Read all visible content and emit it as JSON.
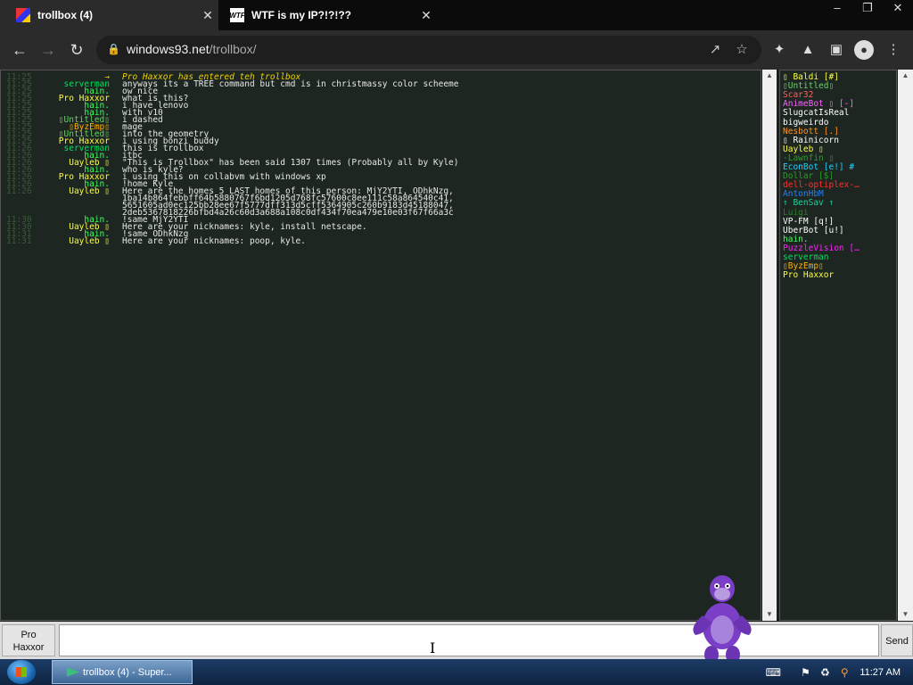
{
  "browser": {
    "tabs": [
      {
        "label": "trollbox (4)"
      },
      {
        "label": "WTF is my IP?!?!??"
      }
    ],
    "tab2_favicon": "WTF",
    "close_glyph": "✕",
    "window_controls": [
      "–",
      "❐",
      "✕"
    ],
    "url_host": "windows93.net",
    "url_path": "/trollbox/"
  },
  "chat": {
    "messages": [
      {
        "time": "11:25",
        "nick": "→",
        "nick_color": "#f0d000",
        "text": "Pro Haxxor has entered teh trollbox",
        "italic": true,
        "text_color": "#f0d000"
      },
      {
        "time": "11:25",
        "nick": "serverman",
        "nick_color": "#00e060",
        "text": "anyways its a TREE command but cmd is in christmassy color scheeme"
      },
      {
        "time": "11:25",
        "nick": "hain.",
        "nick_color": "#40ff60",
        "text": "ow nice"
      },
      {
        "time": "11:25",
        "nick": "Pro Haxxor",
        "nick_color": "#ffff40",
        "text": "what is this?"
      },
      {
        "time": "11:25",
        "nick": "hain.",
        "nick_color": "#40ff60",
        "text": "i have lenovo"
      },
      {
        "time": "11:25",
        "nick": "hain.",
        "nick_color": "#40ff60",
        "text": "with v10"
      },
      {
        "time": "11:25",
        "nick": "▯Untitled▯",
        "nick_color": "#6cd06c",
        "text": "i dashed"
      },
      {
        "time": "11:25",
        "nick": "▯ByzEmp▯",
        "nick_color": "#ffb000",
        "text": "mage"
      },
      {
        "time": "11:25",
        "nick": "▯Untitled▯",
        "nick_color": "#6cd06c",
        "text": "into the geometry"
      },
      {
        "time": "11:25",
        "nick": "Pro Haxxor",
        "nick_color": "#ffff40",
        "text": "i using bonzi buddy"
      },
      {
        "time": "11:26",
        "nick": "serverman",
        "nick_color": "#00e060",
        "text": "this is trollbox"
      },
      {
        "time": "11:26",
        "nick": "hain.",
        "nick_color": "#40ff60",
        "text": "itbc"
      },
      {
        "time": "11:26",
        "nick": "Uayleb ▯",
        "nick_color": "#ffff40",
        "text": "\"This is Trollbox\" has been said 1307 times (Probably all by Kyle)"
      },
      {
        "time": "11:26",
        "nick": "hain.",
        "nick_color": "#40ff60",
        "text": "who is kyle?"
      },
      {
        "time": "11:26",
        "nick": "Pro Haxxor",
        "nick_color": "#ffff40",
        "text": "i using this on collabvm with windows xp"
      },
      {
        "time": "11:26",
        "nick": "hain.",
        "nick_color": "#40ff60",
        "text": "!home Kyle"
      },
      {
        "time": "11:26",
        "nick": "Uayleb ▯",
        "nick_color": "#ffff40",
        "text": "Here are the homes 5 LAST homes of this person: MjY2YTI, ODhkNzg,"
      },
      {
        "time": "",
        "nick": "",
        "nick_color": "#ffff40",
        "text": "1ba14b864febbff64b5880767f6bd1205d768fc57600c8ee111c58a864540c41,"
      },
      {
        "time": "",
        "nick": "",
        "nick_color": "#ffff40",
        "text": "5651605ad0ec125bb28ee67f5777dff313d5cff5364905c260b9183d45188047,"
      },
      {
        "time": "",
        "nick": "",
        "nick_color": "#ffff40",
        "text": "2deb5367818226bfbd4a26c60d3a688a108c0df434f70ea479e10e03f67f66a3c"
      },
      {
        "time": "11:30",
        "nick": "hain.",
        "nick_color": "#40ff60",
        "text": "!same MjY2YTI"
      },
      {
        "time": "11:30",
        "nick": "Uayleb ▯",
        "nick_color": "#ffff40",
        "text": "Here are your nicknames: kyle, install netscape."
      },
      {
        "time": "11:31",
        "nick": "hain.",
        "nick_color": "#40ff60",
        "text": "!same ODhkNzg"
      },
      {
        "time": "11:31",
        "nick": "Uayleb ▯",
        "nick_color": "#ffff40",
        "text": "Here are your nicknames: poop, kyle."
      }
    ]
  },
  "users": [
    {
      "name": "▯ Baldi [#]",
      "color": "#ffff40"
    },
    {
      "name": "▯Untitled▯",
      "color": "#6cd06c"
    },
    {
      "name": "Scar32",
      "color": "#ff6060"
    },
    {
      "name": "AnimeBot ▯ [-]",
      "color": "#ff60ff"
    },
    {
      "name": "SlugcatIsReal",
      "color": "#ffffff"
    },
    {
      "name": "bigweirdo",
      "color": "#ffffff"
    },
    {
      "name": "Nesbott [.]",
      "color": "#ff9020"
    },
    {
      "name": "▯ Rainicorn",
      "color": "#ffffff"
    },
    {
      "name": "Uayleb ▯",
      "color": "#ffff40"
    },
    {
      "name": "-Lawnfin ▯",
      "color": "#2b9c2b"
    },
    {
      "name": "EconBot [e!] #",
      "color": "#20d0ff"
    },
    {
      "name": "Dollar [$]",
      "color": "#2b9c2b"
    },
    {
      "name": "dell-optiplex-…",
      "color": "#ff3030"
    },
    {
      "name": "AntonHbM",
      "color": "#2080ff"
    },
    {
      "name": "↑ BenSav ↑",
      "color": "#20d0a0"
    },
    {
      "name": "Luigi",
      "color": "#2b7c2b"
    },
    {
      "name": "VP-FM [q!]",
      "color": "#ffffff"
    },
    {
      "name": "UberBot [u!]",
      "color": "#ffffff"
    },
    {
      "name": "hain.",
      "color": "#40ff60"
    },
    {
      "name": "PuzzleVision […",
      "color": "#ff20ff"
    },
    {
      "name": "serverman",
      "color": "#00e060"
    },
    {
      "name": "▯ByzEmp▯",
      "color": "#ffb000"
    },
    {
      "name": "Pro Haxxor",
      "color": "#ffff40"
    }
  ],
  "input": {
    "nick_line1": "Pro",
    "nick_line2": "Haxxor",
    "value": "",
    "send_label": "Send"
  },
  "taskbar": {
    "task_label": "trollbox (4) - Super...",
    "clock": "11:27 AM"
  }
}
